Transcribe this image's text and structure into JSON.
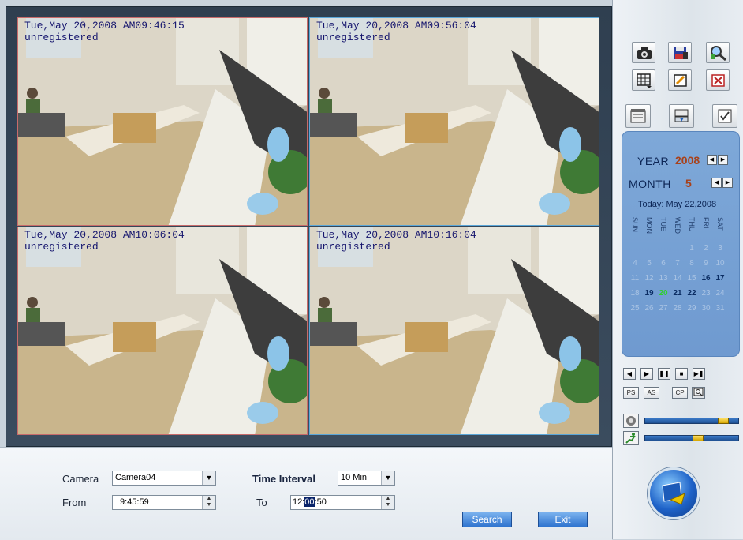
{
  "tiles": [
    {
      "date": "Tue,May 20,2008 AM09:46:15",
      "status": "unregistered"
    },
    {
      "date": "Tue,May 20,2008 AM09:56:04",
      "status": "unregistered"
    },
    {
      "date": "Tue,May 20,2008 AM10:06:04",
      "status": "unregistered"
    },
    {
      "date": "Tue,May 20,2008 AM10:16:04",
      "status": "unregistered"
    }
  ],
  "search": {
    "camera_label": "Camera",
    "camera_value": "Camera04",
    "interval_label": "Time Interval",
    "interval_value": "10 Min",
    "from_label": "From",
    "from_value": "9:45:59",
    "to_label": "To",
    "to_hour": "12:",
    "to_selected": "00",
    "to_rest": ":50",
    "search_button": "Search",
    "exit_button": "Exit"
  },
  "toolbar_icons": [
    "camera-icon",
    "floppy-save-icon",
    "magnifier-icon",
    "grid-layout-icon",
    "edit-note-icon",
    "close-icon",
    "calendar-note-icon",
    "device-list-icon",
    "checklist-icon"
  ],
  "calendar": {
    "year_label": "YEAR",
    "year_value": "2008",
    "month_label": "MONTH",
    "month_value": "5",
    "today": "Today: May 22,2008",
    "weekdays": [
      "SUN",
      "MON",
      "TUE",
      "WED",
      "THU",
      "FRI",
      "SAT"
    ],
    "weeks": [
      [
        "",
        "",
        "",
        "",
        "1",
        "2",
        "3"
      ],
      [
        "4",
        "5",
        "6",
        "7",
        "8",
        "9",
        "10"
      ],
      [
        "11",
        "12",
        "13",
        "14",
        "15",
        "16",
        "17"
      ],
      [
        "18",
        "19",
        "20",
        "21",
        "22",
        "23",
        "24"
      ],
      [
        "25",
        "26",
        "27",
        "28",
        "29",
        "30",
        "31"
      ]
    ],
    "days_with_records": [
      "16",
      "17",
      "19",
      "21",
      "22"
    ],
    "selected_day": "20"
  },
  "playback": {
    "buttons": [
      "rewind-icon",
      "forward-icon",
      "pause-icon",
      "stop-icon",
      "step-forward-icon"
    ],
    "ps_label": "PS",
    "as_label": "AS",
    "cp_label": "CP",
    "volume_level": 0.88,
    "speed_level": 0.58
  },
  "colors": {
    "accent": "#2f74cf",
    "calendar_bg": "#7ea8d8",
    "osd_text": "#16166e",
    "selected_day": "#2fcf2f",
    "recorded_day": "#0b2d63"
  }
}
